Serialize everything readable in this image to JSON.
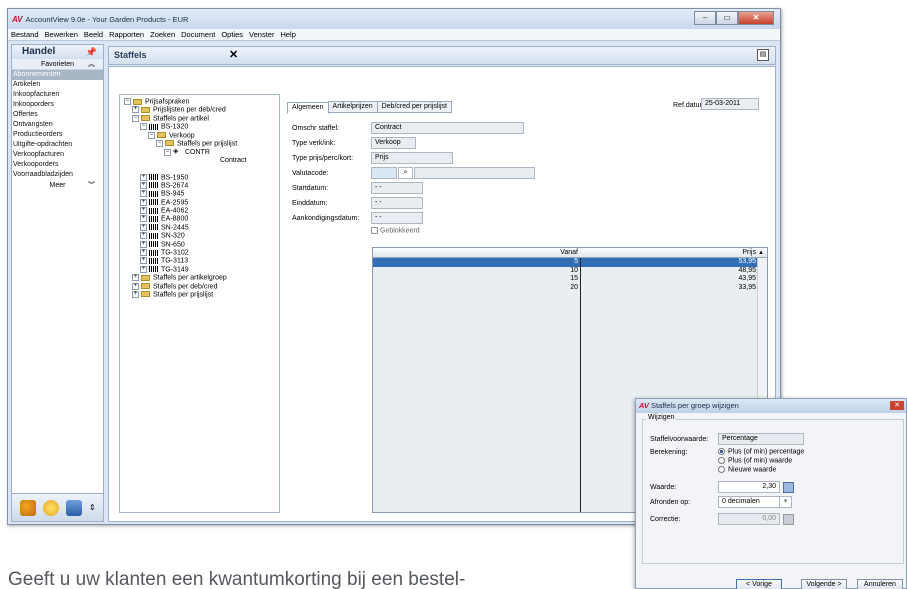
{
  "window": {
    "logo": "AV",
    "title": "AccountView 9.0e - Your Garden Products - EUR"
  },
  "menu": [
    "Bestand",
    "Bewerken",
    "Beeld",
    "Rapporten",
    "Zoeken",
    "Document",
    "Opties",
    "Venster",
    "Help"
  ],
  "leftpanel": {
    "title": "Handel",
    "favorites": "Favorieten",
    "items": [
      "Abonnementen",
      "Artikelen",
      "Inkoopfacturen",
      "Inkooporders",
      "Offertes",
      "Ontvangsten",
      "Productieorders",
      "Uitgifte-opdrachten",
      "Verkoopfacturen",
      "Verkooporders",
      "Voorraadbladzijden"
    ],
    "more": "Meer"
  },
  "tab": {
    "title": "Staffels",
    "close": "✕"
  },
  "tree": [
    {
      "label": "Prijsafspraken",
      "indent": 0,
      "exp": "−",
      "icon": "fld"
    },
    {
      "label": "Prijslijsten per deb/cred",
      "indent": 1,
      "exp": "+",
      "icon": "fld"
    },
    {
      "label": "Staffels per artikel",
      "indent": 1,
      "exp": "−",
      "icon": "fld"
    },
    {
      "label": "BS-1320",
      "indent": 2,
      "exp": "−",
      "icon": "bar"
    },
    {
      "label": "Verkoop",
      "indent": 3,
      "exp": "−",
      "icon": "fld"
    },
    {
      "label": "Staffels per prijslijst",
      "indent": 4,
      "exp": "−",
      "icon": "fld"
    },
    {
      "label": "CONTR",
      "indent": 5,
      "exp": "−",
      "icon": "eye"
    },
    {
      "label": "Contract",
      "indent": 6,
      "exp": "",
      "icon": "none"
    },
    {
      "label": "",
      "indent": 0,
      "exp": "",
      "icon": "none"
    },
    {
      "label": "BS-1950",
      "indent": 2,
      "exp": "+",
      "icon": "bar"
    },
    {
      "label": "BS-2674",
      "indent": 2,
      "exp": "+",
      "icon": "bar"
    },
    {
      "label": "BS-945",
      "indent": 2,
      "exp": "+",
      "icon": "bar"
    },
    {
      "label": "EA-2595",
      "indent": 2,
      "exp": "+",
      "icon": "bar"
    },
    {
      "label": "EA-4062",
      "indent": 2,
      "exp": "+",
      "icon": "bar"
    },
    {
      "label": "EA-8800",
      "indent": 2,
      "exp": "+",
      "icon": "bar"
    },
    {
      "label": "SN-2445",
      "indent": 2,
      "exp": "+",
      "icon": "bar"
    },
    {
      "label": "SN-320",
      "indent": 2,
      "exp": "+",
      "icon": "bar"
    },
    {
      "label": "SN-650",
      "indent": 2,
      "exp": "+",
      "icon": "bar"
    },
    {
      "label": "TG-3102",
      "indent": 2,
      "exp": "+",
      "icon": "bar"
    },
    {
      "label": "TG-3113",
      "indent": 2,
      "exp": "+",
      "icon": "bar"
    },
    {
      "label": "TG-3149",
      "indent": 2,
      "exp": "+",
      "icon": "bar"
    },
    {
      "label": "Staffels per artikelgroep",
      "indent": 1,
      "exp": "+",
      "icon": "fld"
    },
    {
      "label": "Staffels per deb/cred",
      "indent": 1,
      "exp": "+",
      "icon": "fld"
    },
    {
      "label": "Staffels per prijslijst",
      "indent": 1,
      "exp": "+",
      "icon": "fld"
    }
  ],
  "detail": {
    "tabs": [
      "Algemeen",
      "Artikelprijzen",
      "Deb/cred per prijslijst"
    ],
    "ref_label": "Ref.datum:",
    "ref_value": "25-03-2011",
    "fields": {
      "omschr": {
        "label": "Omschr staffel:",
        "value": "Contract"
      },
      "type": {
        "label": "Type verk/ink:",
        "value": "Verkoop"
      },
      "prijs": {
        "label": "Type prijs/perc/kort:",
        "value": "Prijs"
      },
      "valuta": {
        "label": "Valutacode:",
        "value": ""
      },
      "start": {
        "label": "Startdatum:",
        "value": "- -"
      },
      "eind": {
        "label": "Einddatum:",
        "value": "- -"
      },
      "aank": {
        "label": "Aankondigingsdatum:",
        "value": "- -"
      }
    },
    "blocked": "Geblokkeerd"
  },
  "grid": {
    "col_vanaf": "Vanaf",
    "col_prijs": "Prijs",
    "rows": [
      [
        "5",
        "53,95"
      ],
      [
        "10",
        "48,95"
      ],
      [
        "15",
        "43,95"
      ],
      [
        "20",
        "33,95"
      ]
    ],
    "selected": 0
  },
  "dialog": {
    "logo": "AV",
    "title": "Staffels per groep wijzigen",
    "group": "Wijzigen",
    "staffel_label": "Staffelvoorwaarde:",
    "staffel_value": "Percentage",
    "ber_label": "Berekening:",
    "options": [
      "Plus (of min) percentage",
      "Plus (of min) waarde",
      "Nieuwe waarde"
    ],
    "selected_option": 0,
    "waarde_label": "Waarde:",
    "waarde_value": "2,30",
    "afronden_label": "Afronden op:",
    "afronden_value": "0 decimalen",
    "correctie_label": "Correctie:",
    "correctie_value": "0,00",
    "buttons": {
      "prev": "< Vorige",
      "next": "Volgende >",
      "cancel": "Annuleren"
    }
  },
  "caption": "Geeft u uw klanten een kwantumkorting bij een bestel-",
  "colors": {
    "accent": "#2e6fb5",
    "brand": "#c8102e",
    "sidebar_selected": "#a9b6c6"
  }
}
